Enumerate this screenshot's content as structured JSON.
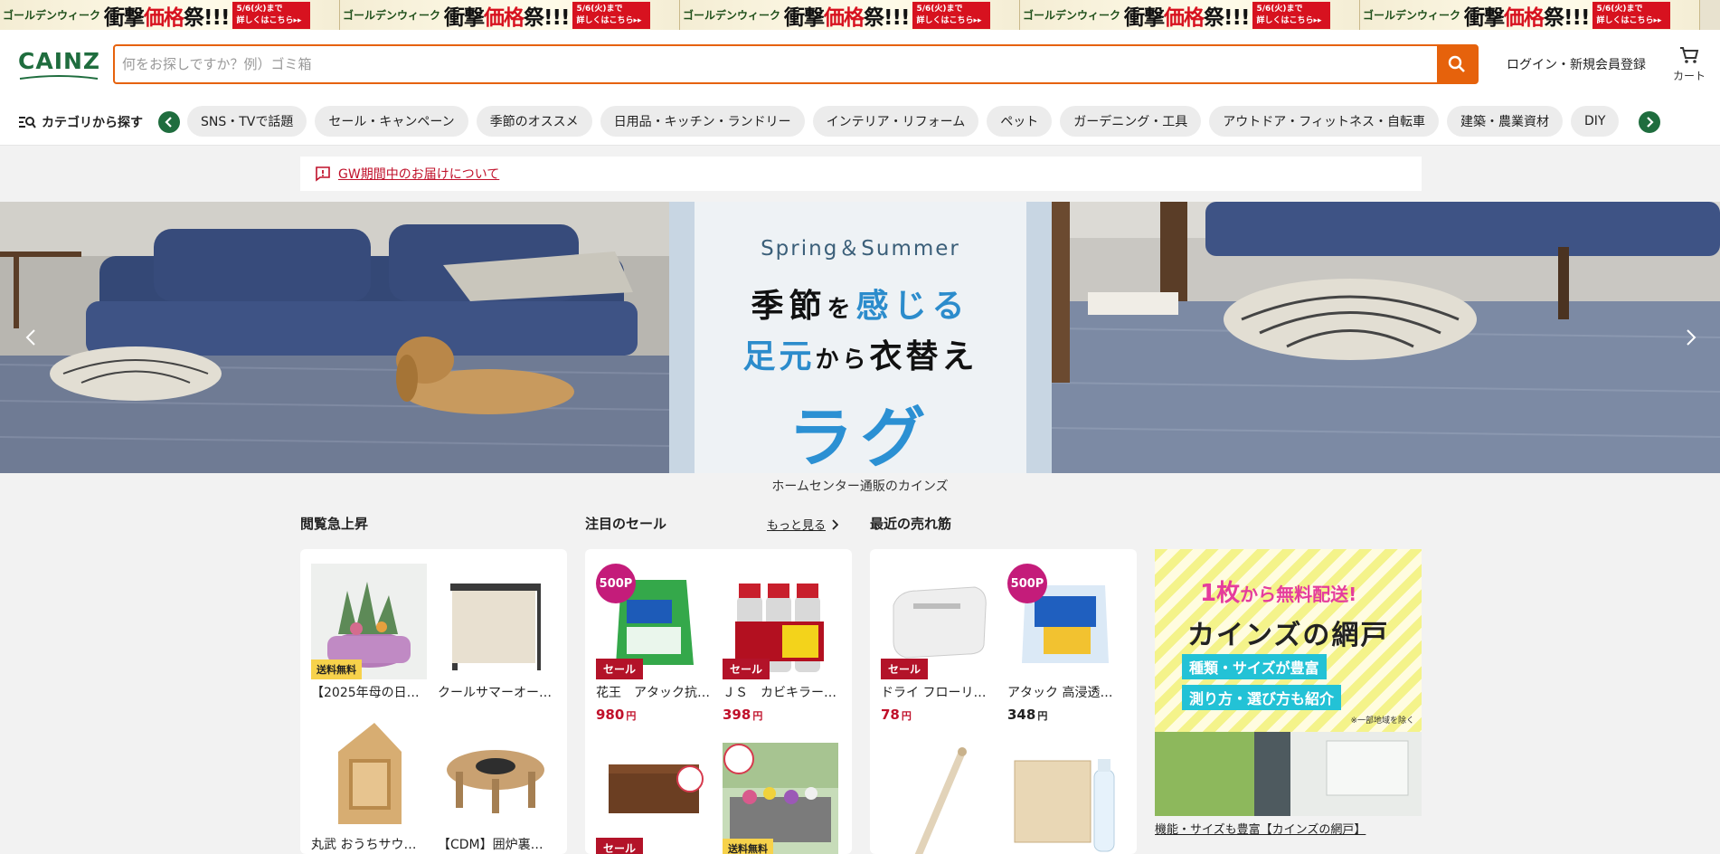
{
  "promo": {
    "gw_text": "ゴールデンウィーク",
    "title_prefix": "衝撃",
    "title_red": "価格",
    "title_suffix": "祭!!!",
    "date_text": "5/6(火)まで",
    "detail_text": "詳しくはこちら▸▸"
  },
  "header": {
    "logo": "CAINZ",
    "search_placeholder": "何をお探しですか？例）ゴミ箱",
    "login_label": "ログイン・新規会員登録",
    "cart_label": "カート"
  },
  "catnav": {
    "browse_label": "カテゴリから探す",
    "chips": [
      "SNS・TVで話題",
      "セール・キャンペーン",
      "季節のオススメ",
      "日用品・キッチン・ランドリー",
      "インテリア・リフォーム",
      "ペット",
      "ガーデニング・工具",
      "アウトドア・フィットネス・自転車",
      "建築・農業資材",
      "DIY"
    ]
  },
  "notice": {
    "link_text": "GW期間中のお届けについて"
  },
  "hero": {
    "season": "Spring＆Summer",
    "line1_a": "季節",
    "line1_b": "を",
    "line1_c": "感じる",
    "line2_a": "足元",
    "line2_b": "から",
    "line2_c": "衣替え",
    "main": "ラグ",
    "caption": "ホームセンター通販のカインズ"
  },
  "sections": {
    "trending_title": "閲覧急上昇",
    "sale_title": "注目のセール",
    "sale_more": "もっと見る",
    "bestseller_title": "最近の売れ筋"
  },
  "trending": [
    {
      "name": "【2025年母の日…",
      "badge": "送料無料"
    },
    {
      "name": "クールサマーオー…",
      "badge": ""
    },
    {
      "name": "丸武 おうちサウ…",
      "badge": ""
    },
    {
      "name": "【CDM】囲炉裏…",
      "badge": ""
    }
  ],
  "sale": [
    {
      "name": "花王　アタック抗…",
      "price": "980",
      "badge": "セール",
      "points": "500P"
    },
    {
      "name": "ＪＳ　カビキラー…",
      "price": "398",
      "badge": "セール",
      "points": ""
    },
    {
      "name": "",
      "price": "",
      "badge": "セール",
      "points": ""
    },
    {
      "name": "",
      "price": "",
      "badge": "送料無料",
      "points": ""
    }
  ],
  "bestseller": [
    {
      "name": "ドライ フローリ…",
      "price": "78",
      "badge": "セール",
      "points": ""
    },
    {
      "name": "アタック 高浸透…",
      "price": "348",
      "badge": "",
      "points": "500P"
    }
  ],
  "yen": "円",
  "ad": {
    "top_num": "1枚",
    "top_text": "から無料配送!",
    "title": "カインズの網戸",
    "tag1": "種類・サイズが豊富",
    "tag2": "測り方・選び方も紹介",
    "note": "※一部地域を除く",
    "caption": "機能・サイズも豊富【カインズの網戸】"
  }
}
